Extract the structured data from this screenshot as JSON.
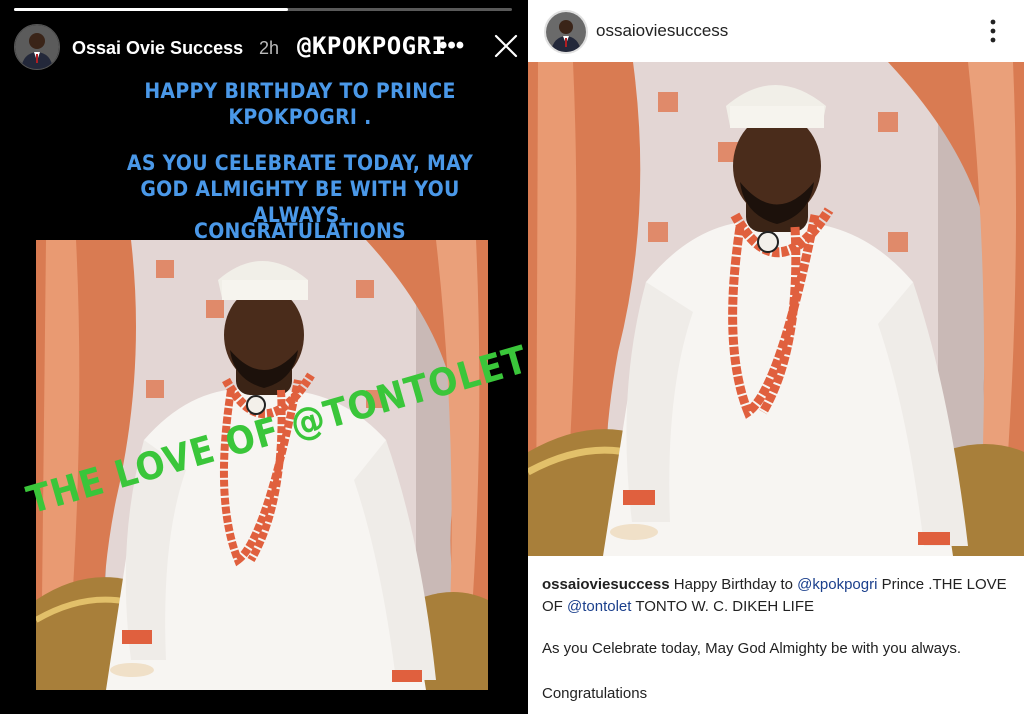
{
  "story": {
    "progress": 0.55,
    "username": "Ossai Ovie Success",
    "time": "2h",
    "mention": "@KPOKPOGRI",
    "more": "•••",
    "text_line1": "HAPPY BIRTHDAY TO PRINCE KPOKPOGRI .",
    "text_line2": "AS YOU CELEBRATE TODAY, MAY GOD ALMIGHTY BE WITH YOU ALWAYS.",
    "text_line3": "CONGRATULATIONS",
    "watermark": "THE LOVE OF @TONTOLET LIFE",
    "close_icon": "close-icon",
    "text_color": "#4a98e8",
    "watermark_color": "#3ac63a"
  },
  "post": {
    "username": "ossaioviesuccess",
    "more_icon": "vertical-ellipsis-icon",
    "caption": {
      "username": "ossaioviesuccess",
      "part1": "Happy Birthday to",
      "mention1": "@kpokpogri",
      "part2": "Prince .THE LOVE OF",
      "mention2": "@tontolet",
      "part3": "TONTO W. C. DIKEH  LIFE",
      "line2": "As you Celebrate today, May God Almighty be with you always.",
      "line3": "Congratulations"
    },
    "mention_color": "#1a3f8c"
  }
}
